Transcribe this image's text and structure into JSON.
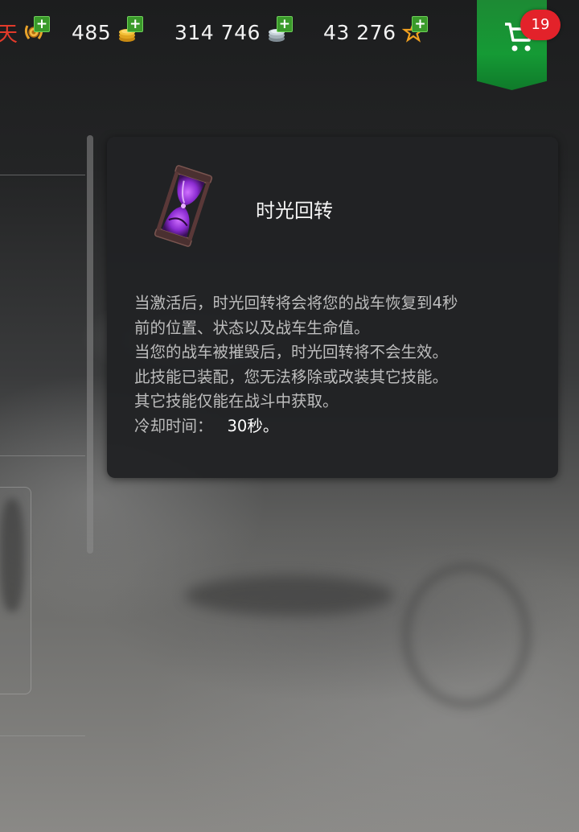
{
  "topbar": {
    "cut_text": "天",
    "resources": [
      {
        "value": "",
        "icon": "laurel-medal-icon",
        "color": "#e8a22a"
      },
      {
        "value": "485",
        "icon": "gold-coins-icon",
        "color": "#f0c030"
      },
      {
        "value": "314 746",
        "icon": "silver-coins-icon",
        "color": "#b8c4cc"
      },
      {
        "value": "43 276",
        "icon": "star-icon",
        "color": "#f0a020"
      }
    ],
    "plus_label": "+"
  },
  "cart": {
    "icon": "shopping-cart-icon",
    "badge_count": "19",
    "color": "#1a8f33"
  },
  "tooltip": {
    "icon": "hourglass-icon",
    "title": "时光回转",
    "lines": [
      "当激活后，时光回转将会将您的战车恢复到4秒",
      "前的位置、状态以及战车生命值。",
      "当您的战车被摧毁后，时光回转将不会生效。",
      "此技能已装配，您无法移除或改装其它技能。",
      "其它技能仅能在战斗中获取。"
    ],
    "cooldown_label": "冷却时间：",
    "cooldown_value": "30秒。"
  }
}
